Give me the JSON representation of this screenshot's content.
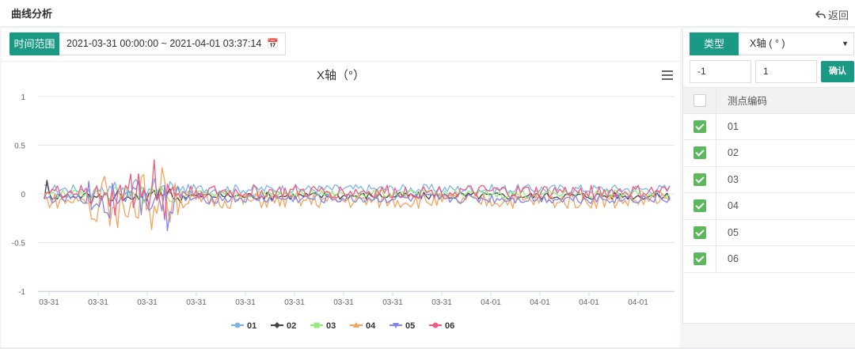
{
  "header": {
    "title": "曲线分析",
    "back_label": "返回"
  },
  "filter": {
    "time_range_label": "时间范围",
    "time_range_value": "2021-03-31 00:00:00 ~ 2021-04-01 03:37:14"
  },
  "side": {
    "type_label": "类型",
    "type_value": "X轴 ( ° )",
    "min_value": "-1",
    "max_value": "1",
    "confirm_label": "确认",
    "table_header": "测点编码",
    "rows": [
      {
        "code": "01",
        "checked": true
      },
      {
        "code": "02",
        "checked": true
      },
      {
        "code": "03",
        "checked": true
      },
      {
        "code": "04",
        "checked": true
      },
      {
        "code": "05",
        "checked": true
      },
      {
        "code": "06",
        "checked": true
      }
    ]
  },
  "chart_data": {
    "type": "line",
    "title": "X轴（°）",
    "ylim": [
      -1,
      1
    ],
    "y_ticks": [
      "1",
      "0.5",
      "0",
      "-0.5",
      "-1"
    ],
    "x_ticks": [
      "03-31",
      "03-31",
      "03-31",
      "03-31",
      "03-31",
      "03-31",
      "03-31",
      "03-31",
      "03-31",
      "04-01",
      "04-01",
      "04-01",
      "04-01"
    ],
    "grid": true,
    "legend_position": "bottom-center",
    "series": [
      {
        "name": "01",
        "color": "#7cb5ec",
        "marker": "circle"
      },
      {
        "name": "02",
        "color": "#434348",
        "marker": "diamond"
      },
      {
        "name": "03",
        "color": "#90ed7d",
        "marker": "square"
      },
      {
        "name": "04",
        "color": "#f7a35c",
        "marker": "triangle"
      },
      {
        "name": "05",
        "color": "#8085e9",
        "marker": "triangle-down"
      },
      {
        "name": "06",
        "color": "#f15c80",
        "marker": "circle"
      }
    ]
  }
}
